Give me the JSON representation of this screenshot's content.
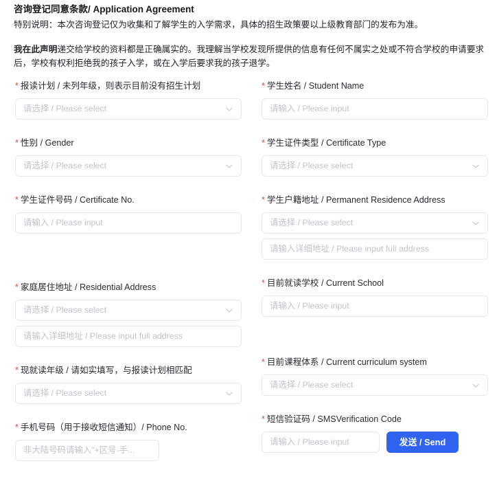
{
  "agreement": {
    "title": "咨询登记同意条款/ Application Agreement",
    "note": "特别说明：本次咨询登记仅为收集和了解学生的入学需求，具体的招生政策要以上级教育部门的发布为准。",
    "declaration_bold": "我在此声明",
    "declaration_rest": "递交给学校的资料都是正确属实的。我理解当学校发现所提供的信息有任何不属实之处或不符合学校的申请要求后，学校有权利拒绝我的孩子入学，或在入学后要求我的孩子退学。"
  },
  "placeholders": {
    "select": "请选择 / Please select",
    "input": "请输入 / Please input",
    "full_address": "请输入详细地址 / Please input full address",
    "phone": "非大陆号码请输入\"+区号-手..."
  },
  "icons": {
    "chevron_down": "chevron-down-icon"
  },
  "colors": {
    "required_asterisk": "#d24b42",
    "send_button": "#2f63f0",
    "field_border": "#e7e7ea",
    "placeholder_text": "#c3c3c9",
    "label_text": "#2b2b30"
  },
  "left_column": [
    {
      "label": "报读计划 / 未列年级，则表示目前没有招生计划",
      "required": true,
      "name": "enrollment-plan",
      "control": "select",
      "placeholder": "请选择 / Please select"
    },
    {
      "label": "性别 / Gender",
      "required": true,
      "name": "gender",
      "control": "select",
      "placeholder": "请选择 / Please select"
    },
    {
      "label": "学生证件号码 / Certificate No.",
      "required": true,
      "name": "certificate-no",
      "control": "input",
      "placeholder": "请输入 / Please input"
    },
    {
      "label": "家庭居住地址 / Residential Address",
      "required": true,
      "name": "residential-address",
      "control": "select",
      "placeholder": "请选择 / Please select",
      "extra_placeholder": "请输入详细地址 / Please input full address"
    },
    {
      "label": "现就读年级 / 请如实填写，与报读计划相匹配",
      "required": true,
      "name": "current-grade",
      "control": "select",
      "placeholder": "请选择 / Please select"
    },
    {
      "label": "手机号码（用于接收短信通知）/ Phone No.",
      "required": true,
      "name": "phone-no",
      "control": "input",
      "placeholder": "非大陆号码请输入\"+区号-手..."
    }
  ],
  "right_column": [
    {
      "label": "学生姓名 / Student Name",
      "required": true,
      "name": "student-name",
      "control": "input",
      "placeholder": "请输入 / Please input"
    },
    {
      "label": "学生证件类型 / Certificate Type",
      "required": true,
      "name": "certificate-type",
      "control": "select",
      "placeholder": "请选择 / Please select"
    },
    {
      "label": "学生户籍地址 / Permanent Residence Address",
      "required": true,
      "name": "permanent-residence-address",
      "control": "select",
      "placeholder": "请选择 / Please select",
      "extra_placeholder": "请输入详细地址 / Please input full address"
    },
    {
      "label": "目前就读学校 / Current School",
      "required": true,
      "name": "current-school",
      "control": "input",
      "placeholder": "请输入 / Please input"
    },
    {
      "label": "目前课程体系 / Current curriculum system",
      "required": true,
      "name": "current-curriculum-system",
      "control": "select",
      "placeholder": "请选择 / Please select"
    },
    {
      "label": "短信验证码 / SMSVerification Code",
      "required": true,
      "name": "sms-verification-code",
      "control": "input-with-button",
      "placeholder": "请输入 / Please input",
      "button_label": "发送 / Send"
    }
  ]
}
